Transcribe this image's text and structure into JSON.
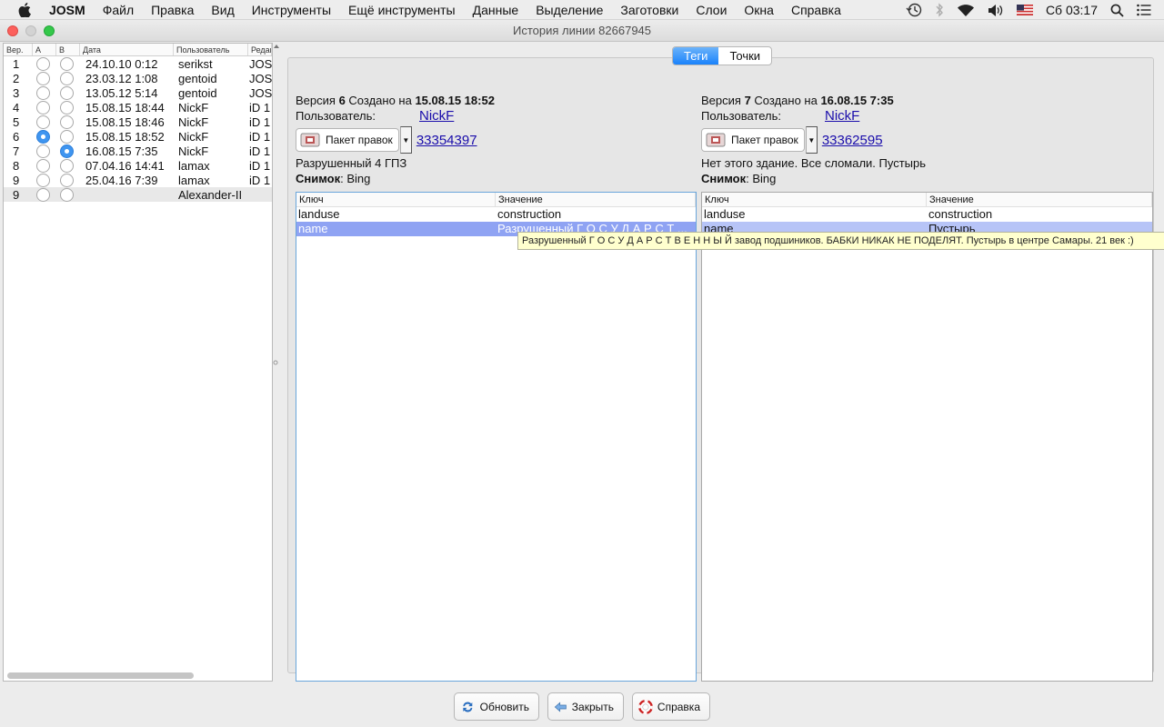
{
  "menubar": {
    "app_name": "JOSM",
    "items": [
      "Файл",
      "Правка",
      "Вид",
      "Инструменты",
      "Ещё инструменты",
      "Данные",
      "Выделение",
      "Заготовки",
      "Слои",
      "Окна",
      "Справка"
    ],
    "clock": "Сб 03:17"
  },
  "window": {
    "title": "История линии 82667945"
  },
  "history_table": {
    "headers": [
      "Вер.",
      "A",
      "B",
      "Дата",
      "Пользователь",
      "Редак"
    ],
    "rows": [
      {
        "version": "1",
        "a": false,
        "b": false,
        "date": "24.10.10 0:12",
        "user": "serikst",
        "editor": "JOSM"
      },
      {
        "version": "2",
        "a": false,
        "b": false,
        "date": "23.03.12 1:08",
        "user": "gentoid",
        "editor": "JOSM"
      },
      {
        "version": "3",
        "a": false,
        "b": false,
        "date": "13.05.12 5:14",
        "user": "gentoid",
        "editor": "JOSM"
      },
      {
        "version": "4",
        "a": false,
        "b": false,
        "date": "15.08.15 18:44",
        "user": "NickF",
        "editor": "iD 1"
      },
      {
        "version": "5",
        "a": false,
        "b": false,
        "date": "15.08.15 18:46",
        "user": "NickF",
        "editor": "iD 1"
      },
      {
        "version": "6",
        "a": true,
        "b": false,
        "date": "15.08.15 18:52",
        "user": "NickF",
        "editor": "iD 1"
      },
      {
        "version": "7",
        "a": false,
        "b": true,
        "date": "16.08.15 7:35",
        "user": "NickF",
        "editor": "iD 1"
      },
      {
        "version": "8",
        "a": false,
        "b": false,
        "date": "07.04.16 14:41",
        "user": "lamax",
        "editor": "iD 1"
      },
      {
        "version": "9",
        "a": false,
        "b": false,
        "date": "25.04.16 7:39",
        "user": "lamax",
        "editor": "iD 1"
      },
      {
        "version": "9",
        "a": false,
        "b": false,
        "date": "",
        "user": "Alexander-II",
        "editor": ""
      }
    ]
  },
  "tabs": {
    "tags": "Теги",
    "nodes": "Точки"
  },
  "left_version": {
    "prefix": "Версия",
    "number": "6",
    "created": "Создано на",
    "date": "15.08.15 18:52",
    "user_label": "Пользователь:",
    "user": "NickF",
    "changeset_button": "Пакет правок",
    "changeset_id": "33354397",
    "comment": "Разрушенный 4 ГПЗ",
    "imagery_label": "Снимок",
    "imagery": ": Bing",
    "col_key": "Ключ",
    "col_value": "Значение",
    "tags": [
      {
        "key": "landuse",
        "value": "construction"
      },
      {
        "key": "name",
        "value": "Разрушенный Г О С У Д А Р С Т ..."
      }
    ]
  },
  "right_version": {
    "prefix": "Версия",
    "number": "7",
    "created": "Создано на",
    "date": "16.08.15 7:35",
    "user_label": "Пользователь:",
    "user": "NickF",
    "changeset_button": "Пакет правок",
    "changeset_id": "33362595",
    "comment": "Нет этого здание. Все сломали. Пустырь",
    "imagery_label": "Снимок",
    "imagery": ": Bing",
    "col_key": "Ключ",
    "col_value": "Значение",
    "tags": [
      {
        "key": "landuse",
        "value": "construction"
      },
      {
        "key": "name",
        "value": "Пустырь"
      }
    ]
  },
  "tooltip": "Разрушенный Г О С У Д А Р С Т В Е Н Н Ы Й завод подшиников. БАБКИ НИКАК НЕ ПОДЕЛЯТ. Пустырь в центре Самары. 21 век :)",
  "buttons": {
    "refresh": "Обновить",
    "close": "Закрыть",
    "help": "Справка"
  },
  "colors": {
    "accent": "#1a82fb",
    "selected_row": "#8fa3f3",
    "tooltip_bg": "#ffffce"
  }
}
